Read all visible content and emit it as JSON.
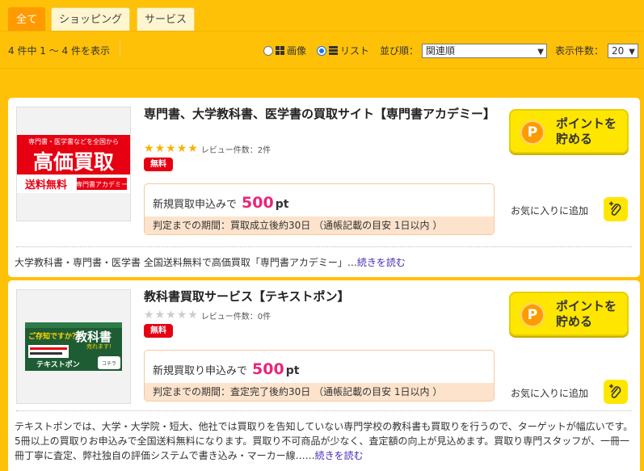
{
  "tabs": [
    {
      "label": "全て",
      "active": true
    },
    {
      "label": "ショッピング",
      "active": false
    },
    {
      "label": "サービス",
      "active": false
    }
  ],
  "toolbar": {
    "count_text": "4 件中 1 ～ 4 件を表示",
    "view_image_label": "画像",
    "view_list_label": "リスト",
    "view_selected": "list",
    "sort_label": "並び順：",
    "sort_value": "関連順",
    "per_page_label": "表示件数：",
    "per_page_value": "20"
  },
  "items": [
    {
      "title": "専門書、大学教科書、医学書の買取サイト【専門書アカデミー】",
      "rating_stars": 5,
      "review_text": "レビュー件数：2件",
      "free_badge": "無料",
      "point_prefix": "新規買取申込みで",
      "point_value": "500",
      "point_unit": "pt",
      "period_text": "判定までの期間：買取成立後約30日 （通帳記載の目安 1日以内 ）",
      "button_label_1": "ポイントを",
      "button_label_2": "貯める",
      "button_icon": "P",
      "fav_label": "お気に入りに追加",
      "description": "大学教科書・専門書・医学書 全国送料無料で高価買取「専門書アカデミー」…",
      "more_label": "続きを読む",
      "banner": {
        "top": "専門書・医学書などを全国から",
        "main": "高価買取",
        "bottom_left": "送料無料",
        "bottom_right": "専門書アカデミー"
      }
    },
    {
      "title": "教科書買取サービス【テキストポン】",
      "rating_stars": 0,
      "review_text": "レビュー件数：0件",
      "free_badge": "無料",
      "point_prefix": "新規買取り申込みで",
      "point_value": "500",
      "point_unit": "pt",
      "period_text": "判定までの期間：査定完了後約30日 （通帳記載の目安 1日以内 ）",
      "button_label_1": "ポイントを",
      "button_label_2": "貯める",
      "button_icon": "P",
      "fav_label": "お気に入りに追加",
      "description": "テキストポンでは、大学・大学院・短大、他社では買取りを告知していない専門学校の教科書も買取りを行うので、ターゲットが幅広いです。5冊以上の買取りお申込みで全国送料無料になります。買取り不可商品が少なく、査定額の向上が見込めます。買取り専門スタッフが、一冊一冊丁寧に査定、弊社独自の評価システムで書き込み・マーカー線……",
      "more_label": "続きを読む",
      "banner": {
        "top": "ご存知ですか？",
        "main": "教科書",
        "sub": "売れます!",
        "brand": "テキストポン",
        "cta": "申込みは コチラ"
      }
    }
  ],
  "colors": {
    "background": "#ffc107",
    "tab_active": "#ff9a00",
    "badge": "#e60012",
    "point_value": "#e8267a",
    "button": "#ffe600",
    "period_bg": "#fde3cc"
  }
}
